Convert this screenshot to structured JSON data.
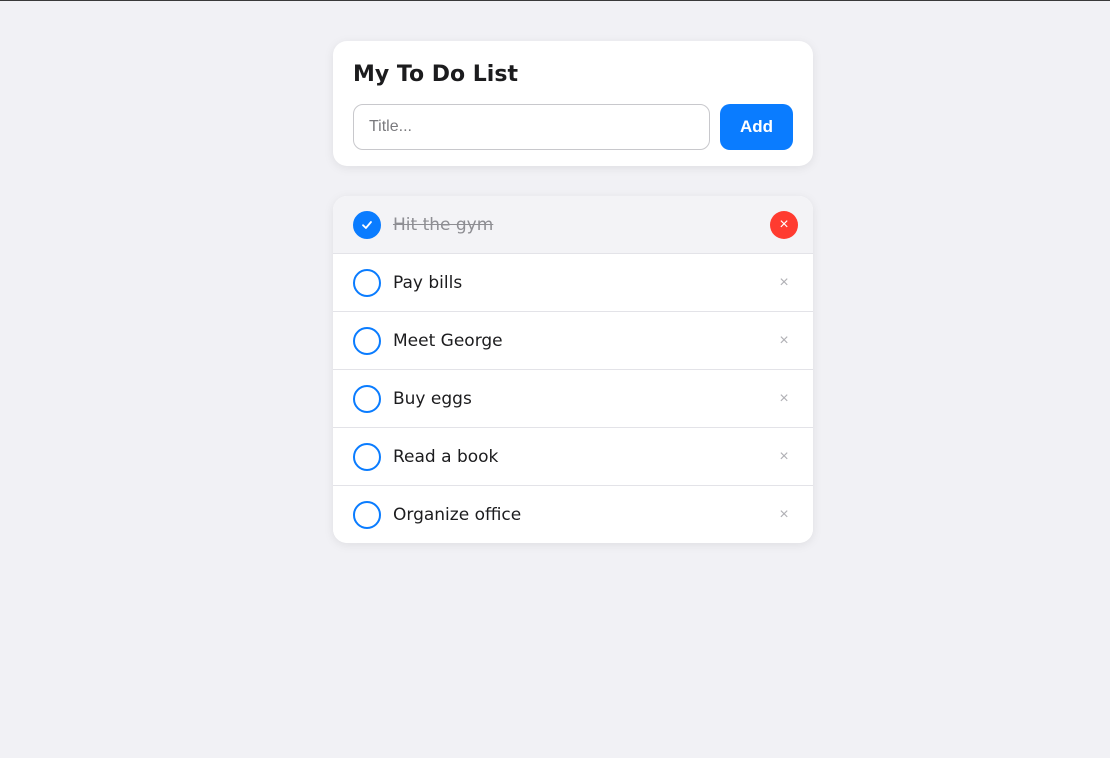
{
  "app": {
    "title": "My To Do List"
  },
  "new_item": {
    "placeholder": "Title...",
    "value": "",
    "add_label": "Add"
  },
  "todos": [
    {
      "text": "Hit the gym",
      "done": true
    },
    {
      "text": "Pay bills",
      "done": false
    },
    {
      "text": "Meet George",
      "done": false
    },
    {
      "text": "Buy eggs",
      "done": false
    },
    {
      "text": "Read a book",
      "done": false
    },
    {
      "text": "Organize office",
      "done": false
    }
  ],
  "icons": {
    "check": "checkmark-icon",
    "delete": "close-icon",
    "delete_glyph": "×"
  },
  "colors": {
    "accent": "#0a7cff",
    "danger": "#ff3b30",
    "background": "#f1f1f5"
  }
}
